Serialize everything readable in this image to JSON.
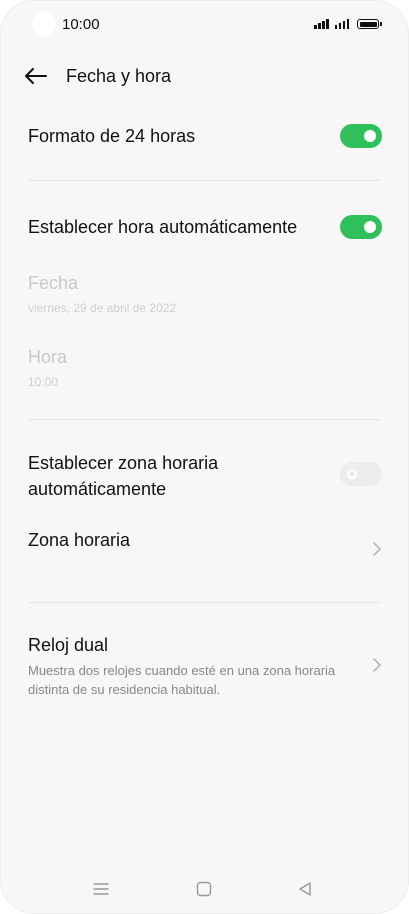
{
  "status_bar": {
    "time": "10:00",
    "icons": [
      "signal-icon",
      "signal-icon",
      "battery-icon"
    ]
  },
  "header": {
    "title": "Fecha y hora",
    "back_icon": "arrow-left-icon"
  },
  "settings": {
    "format_24h": {
      "label": "Formato de 24 horas",
      "enabled": true
    },
    "auto_time": {
      "label": "Establecer hora automáticamente",
      "enabled": true
    },
    "date": {
      "label": "Fecha",
      "value": "viernes, 29 de abril de 2022"
    },
    "hour": {
      "label": "Hora",
      "value": "10:00"
    },
    "auto_timezone": {
      "label_line1": "Establecer zona horaria",
      "label_line2": "automáticamente",
      "enabled": false
    },
    "timezone": {
      "label": "Zona horaria"
    },
    "dual_clock": {
      "label": "Reloj dual",
      "description_line1": "Muestra dos relojes cuando esté en una zona horaria",
      "description_line2": "distinta de su residencia habitual."
    }
  },
  "colors": {
    "toggle_on": "#2fbf5b",
    "toggle_off": "#ececec",
    "background": "#f7f7f7"
  },
  "nav_bar": {
    "icons": [
      "menu-icon",
      "home-icon",
      "back-triangle-icon"
    ]
  }
}
